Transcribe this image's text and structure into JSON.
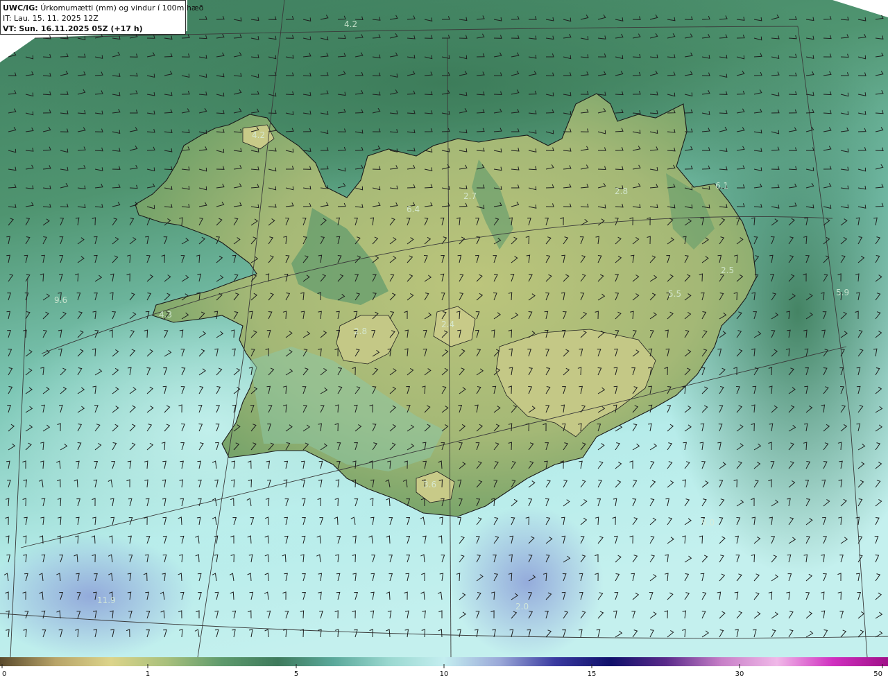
{
  "header": {
    "model": "UWC/IG:",
    "title": "Úrkomumætti (mm) og vindur í 100m hæð",
    "it_label": "IT:",
    "it_value": "Lau. 15. 11. 2025 12Z",
    "vt_label": "VT:",
    "vt_value": "Sun. 16.11.2025 05Z (+17 h)"
  },
  "map_values": [
    "4.2",
    "4.2",
    "6.4",
    "2.7",
    "2.8",
    "6.1",
    "9.6",
    "4.3",
    "2.8",
    "2.4",
    "5.5",
    "2.5",
    "5.9",
    "3.6",
    "9.0",
    "11.9",
    "2.0"
  ],
  "colorbar": {
    "ticks": [
      "0",
      "1",
      "5",
      "10",
      "15",
      "30",
      "50"
    ],
    "tick_values": [
      0,
      1,
      5,
      10,
      15,
      30,
      50
    ],
    "colors": [
      "#5a4a2c",
      "#b8a468",
      "#dcd48a",
      "#a8c07c",
      "#5e9a6c",
      "#3e7a5c",
      "#5aa89a",
      "#9ad8d0",
      "#c4eef0",
      "#9aa8d8",
      "#3a3aa0",
      "#10106a",
      "#5a2a8a",
      "#c880c8",
      "#f0b8e8",
      "#d030c0",
      "#a01088"
    ]
  },
  "colors": {
    "ocean_dark": "#3f7f5f",
    "ocean_light": "#b9ecea",
    "land_low": "#5d9566",
    "land_high": "#b4c078",
    "coast": "#1b1b1b",
    "grid": "#3a3a3a"
  }
}
